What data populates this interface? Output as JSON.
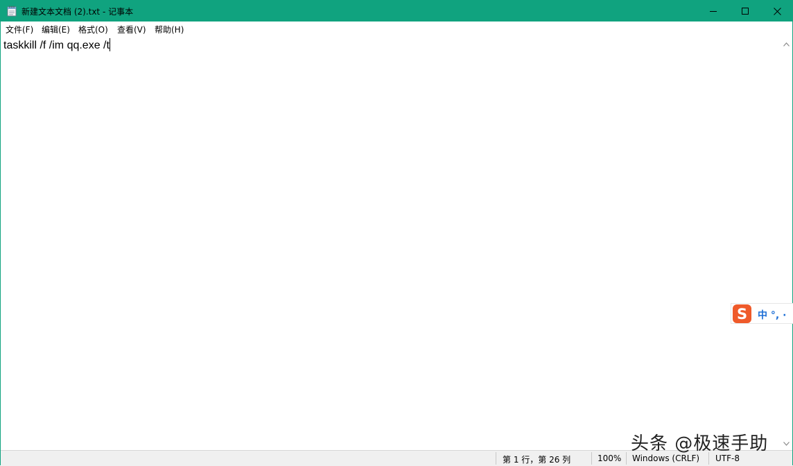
{
  "window": {
    "title": "新建文本文档 (2).txt - 记事本",
    "accent_color": "#10a37f",
    "icon": "notepad-icon"
  },
  "window_controls": {
    "minimize_icon": "minimize-icon",
    "maximize_icon": "maximize-icon",
    "close_icon": "close-icon"
  },
  "menu": {
    "items": [
      {
        "label": "文件(F)"
      },
      {
        "label": "编辑(E)"
      },
      {
        "label": "格式(O)"
      },
      {
        "label": "查看(V)"
      },
      {
        "label": "帮助(H)"
      }
    ]
  },
  "editor": {
    "content": "taskkill /f /im qq.exe /t"
  },
  "status": {
    "position": "第 1 行，第 26 列",
    "zoom": "100%",
    "line_ending": "Windows (CRLF)",
    "encoding": "UTF-8"
  },
  "ime": {
    "logo": "S",
    "text": "中 °, ·"
  },
  "watermark": {
    "text": "头条 @极速手助"
  }
}
